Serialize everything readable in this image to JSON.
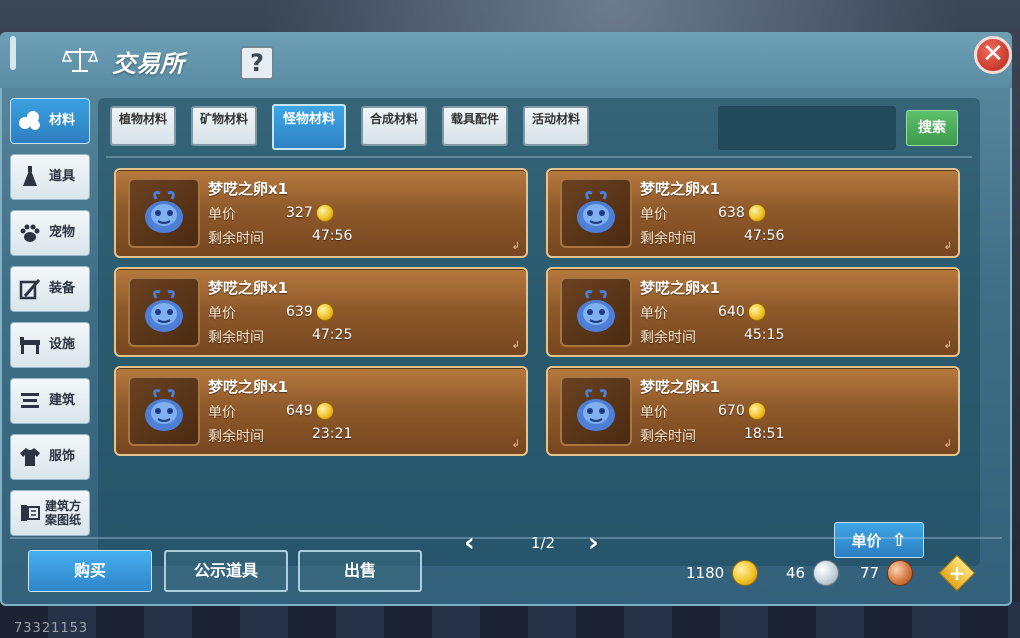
{
  "window": {
    "title": "交易所",
    "help_label": "?",
    "close_label": "✕"
  },
  "sidebar": {
    "items": [
      {
        "label": "材料",
        "icon": "materials-icon",
        "active": true
      },
      {
        "label": "道具",
        "icon": "item-icon",
        "active": false
      },
      {
        "label": "宠物",
        "icon": "paw-icon",
        "active": false
      },
      {
        "label": "装备",
        "icon": "equipment-icon",
        "active": false
      },
      {
        "label": "设施",
        "icon": "facility-icon",
        "active": false
      },
      {
        "label": "建筑",
        "icon": "building-icon",
        "active": false
      },
      {
        "label": "服饰",
        "icon": "clothing-icon",
        "active": false
      },
      {
        "label": "建筑方案图纸",
        "icon": "blueprint-icon",
        "active": false
      }
    ]
  },
  "tabs": [
    {
      "label": "植物材料",
      "active": false
    },
    {
      "label": "矿物材料",
      "active": false
    },
    {
      "label": "怪物材料",
      "active": true
    },
    {
      "label": "合成材料",
      "active": false
    },
    {
      "label": "载具配件",
      "active": false
    },
    {
      "label": "活动材料",
      "active": false
    }
  ],
  "search": {
    "placeholder": "",
    "value": "",
    "button_label": "搜索"
  },
  "listing_labels": {
    "price_label": "单价",
    "time_label": "剩余时间"
  },
  "listings": [
    {
      "name": "梦呓之卵x1",
      "price": "327",
      "time": "47:56"
    },
    {
      "name": "梦呓之卵x1",
      "price": "638",
      "time": "47:56"
    },
    {
      "name": "梦呓之卵x1",
      "price": "639",
      "time": "47:25"
    },
    {
      "name": "梦呓之卵x1",
      "price": "640",
      "time": "45:15"
    },
    {
      "name": "梦呓之卵x1",
      "price": "649",
      "time": "23:21"
    },
    {
      "name": "梦呓之卵x1",
      "price": "670",
      "time": "18:51"
    }
  ],
  "pagination": {
    "text": "1/2"
  },
  "sort": {
    "label": "单价"
  },
  "actions": {
    "buy": "购买",
    "publicize": "公示道具",
    "sell": "出售"
  },
  "currency": {
    "gold": "1180",
    "silver": "46",
    "bronze": "77"
  },
  "footer": {
    "player_id": "73321153"
  },
  "colors": {
    "panel_teal": "#3f6f87",
    "accent_blue": "#2f83c4",
    "card_brown": "#8f5a2b",
    "search_green": "#3e9a4e",
    "close_red": "#c63a2e"
  }
}
